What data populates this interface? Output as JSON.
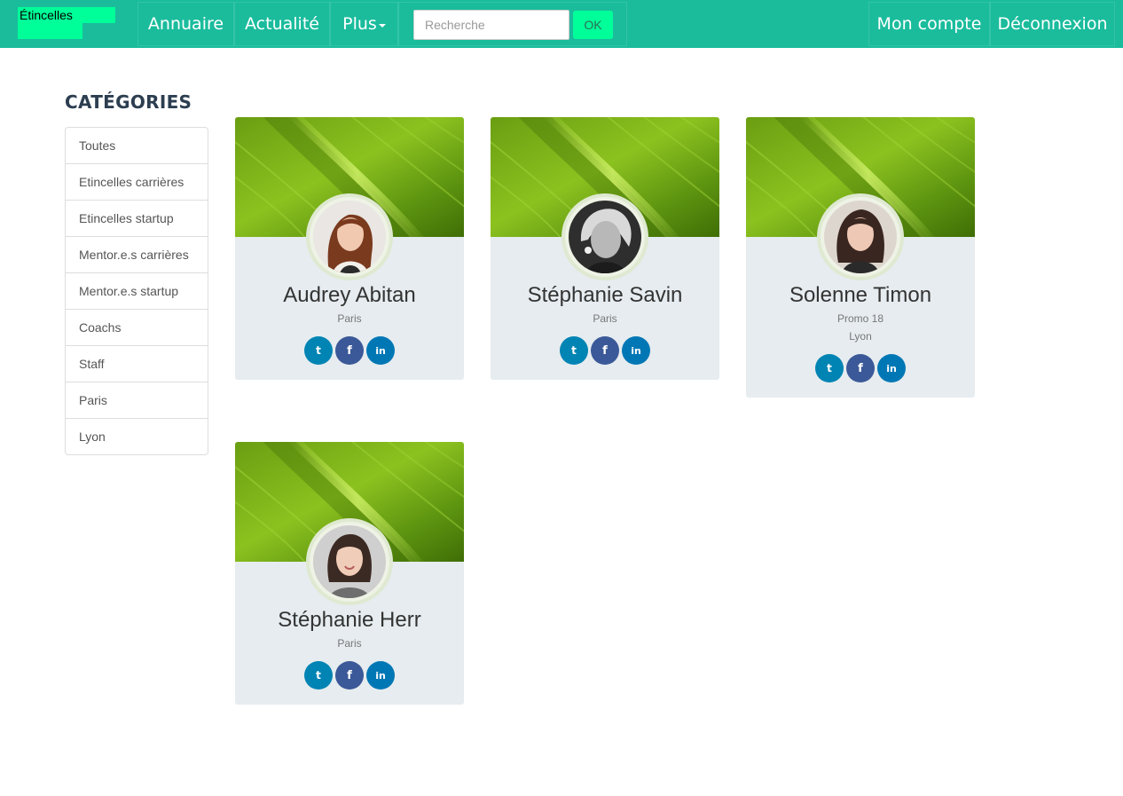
{
  "navbar": {
    "brand": "Étincelles",
    "links": [
      "Annuaire",
      "Actualité",
      "Plus"
    ],
    "search": {
      "placeholder": "Recherche",
      "value": "",
      "button": "OK"
    },
    "right_links": [
      "Mon compte",
      "Déconnexion"
    ]
  },
  "sidebar": {
    "title": "CATÉGORIES",
    "items": [
      {
        "label": "Toutes"
      },
      {
        "label": "Etincelles carrières"
      },
      {
        "label": "Etincelles startup"
      },
      {
        "label": "Mentor.e.s carrières"
      },
      {
        "label": "Mentor.e.s startup"
      },
      {
        "label": "Coachs"
      },
      {
        "label": "Staff"
      },
      {
        "label": "Paris"
      },
      {
        "label": "Lyon"
      }
    ]
  },
  "profiles": [
    {
      "name": "Audrey Abitan",
      "meta": [
        "Paris"
      ]
    },
    {
      "name": "Stéphanie Savin",
      "meta": [
        "Paris"
      ]
    },
    {
      "name": "Solenne Timon",
      "meta": [
        "Promo 18",
        "Lyon"
      ]
    },
    {
      "name": "Stéphanie Herr",
      "meta": [
        "Paris"
      ]
    }
  ],
  "social_icons": [
    "twitter-icon",
    "facebook-icon",
    "linkedin-icon"
  ],
  "colors": {
    "navbar": "#1abc9c",
    "brand_block": "#00ff99",
    "card_bg": "#e6ecef",
    "twitter": "#0084b4",
    "facebook": "#3b5998",
    "linkedin": "#0077b5"
  }
}
